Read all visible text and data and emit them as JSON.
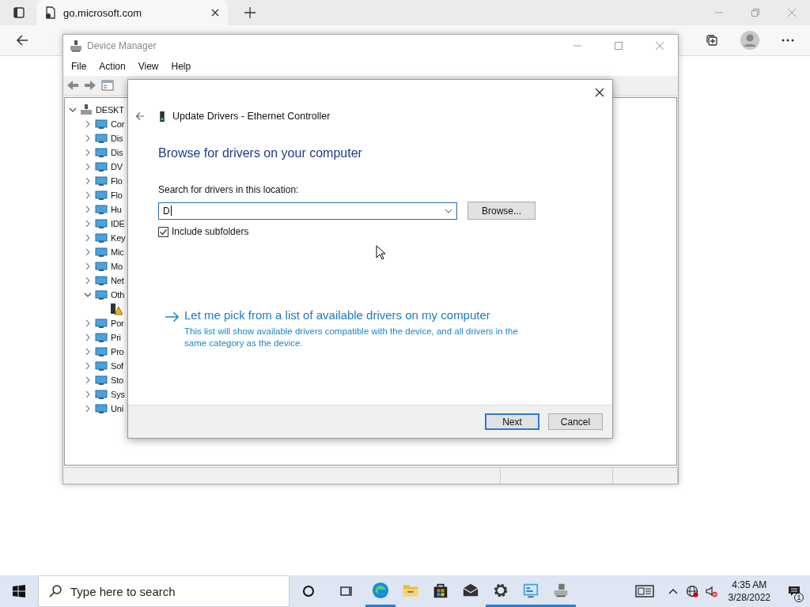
{
  "browser": {
    "tab": {
      "title": "go.microsoft.com"
    }
  },
  "device_manager": {
    "title": "Device Manager",
    "menu": [
      "File",
      "Action",
      "View",
      "Help"
    ],
    "tree": [
      {
        "kind": "computer",
        "label": "DESKT",
        "expanded": true,
        "children": [
          {
            "kind": "category",
            "label": "Cor",
            "expanded": false
          },
          {
            "kind": "category",
            "label": "Dis",
            "expanded": false
          },
          {
            "kind": "category",
            "label": "Dis",
            "expanded": false
          },
          {
            "kind": "category",
            "label": "DV",
            "expanded": false
          },
          {
            "kind": "category",
            "label": "Flo",
            "expanded": false
          },
          {
            "kind": "category",
            "label": "Flo",
            "expanded": false
          },
          {
            "kind": "category",
            "label": "Hu",
            "expanded": false
          },
          {
            "kind": "category",
            "label": "IDE",
            "expanded": false
          },
          {
            "kind": "category",
            "label": "Key",
            "expanded": false
          },
          {
            "kind": "category",
            "label": "Mic",
            "expanded": false
          },
          {
            "kind": "category",
            "label": "Mo",
            "expanded": false
          },
          {
            "kind": "category",
            "label": "Net",
            "expanded": false
          },
          {
            "kind": "category",
            "label": "Oth",
            "expanded": true,
            "children": [
              {
                "kind": "warning-device"
              }
            ]
          },
          {
            "kind": "category",
            "label": "Por",
            "expanded": false
          },
          {
            "kind": "category",
            "label": "Pri",
            "expanded": false
          },
          {
            "kind": "category",
            "label": "Pro",
            "expanded": false
          },
          {
            "kind": "category",
            "label": "Sof",
            "expanded": false
          },
          {
            "kind": "category",
            "label": "Sto",
            "expanded": false
          },
          {
            "kind": "category",
            "label": "Sys",
            "expanded": false
          },
          {
            "kind": "category",
            "label": "Uni",
            "expanded": false
          }
        ]
      }
    ]
  },
  "dialog": {
    "title": "Update Drivers - Ethernet Controller",
    "heading": "Browse for drivers on your computer",
    "location_label": "Search for drivers in this location:",
    "location": {
      "value": "D"
    },
    "browse_button": "Browse...",
    "include_subfolders": {
      "label": "Include subfolders",
      "checked": true
    },
    "pick_link": {
      "title": "Let me pick from a list of available drivers on my computer",
      "description": "This list will show available drivers compatible with the device, and all drivers in the same category as the device."
    },
    "buttons": [
      {
        "label": "Next",
        "default": true
      },
      {
        "label": "Cancel",
        "default": false
      }
    ]
  },
  "taskbar": {
    "search": {
      "placeholder": "Type here to search"
    },
    "apps": [
      {
        "kind": "edge",
        "running": true
      },
      {
        "kind": "explorer",
        "running": false
      },
      {
        "kind": "store",
        "running": false
      },
      {
        "kind": "mail",
        "running": false
      },
      {
        "kind": "settings",
        "running": true
      },
      {
        "kind": "control-panel",
        "running": true
      },
      {
        "kind": "device-manager",
        "running": true
      }
    ],
    "clock": {
      "time": "4:35 AM",
      "date": "3/28/2022"
    },
    "notifications": {
      "count": "1"
    }
  }
}
